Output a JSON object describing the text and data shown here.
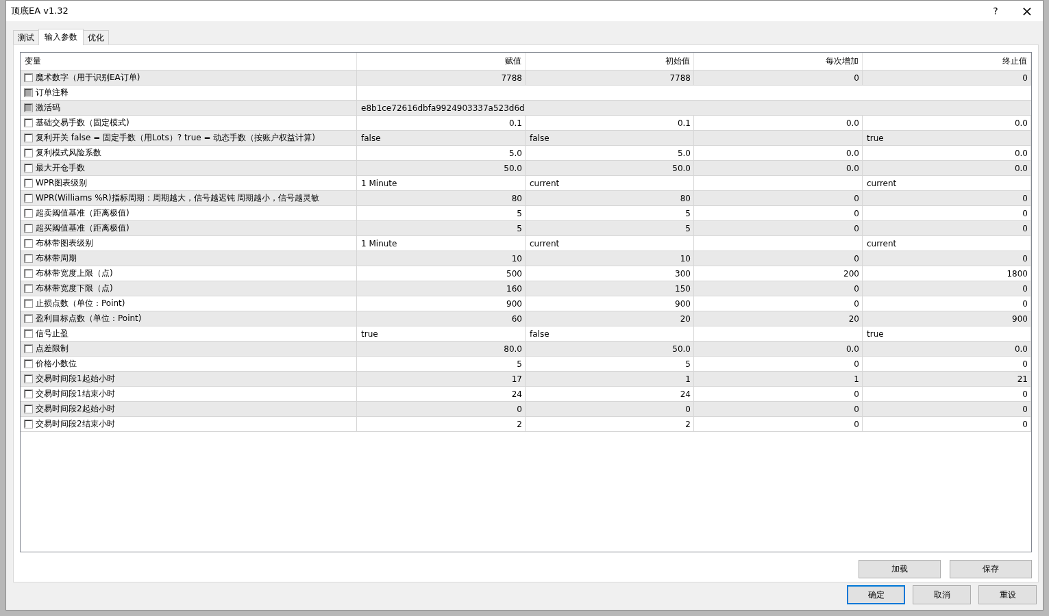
{
  "window": {
    "title": "顶底EA v1.32",
    "help": "?",
    "close": "×"
  },
  "tabs": [
    {
      "label": "测试",
      "selected": false
    },
    {
      "label": "输入参数",
      "selected": true
    },
    {
      "label": "优化",
      "selected": false
    }
  ],
  "table": {
    "columns": [
      "变量",
      "赋值",
      "初始值",
      "每次增加",
      "终止值"
    ],
    "rows": [
      {
        "kind": "number",
        "name": "魔术数字（用于识别EA订单)",
        "checked": false,
        "disabled": false,
        "value": "7788",
        "start": "7788",
        "step": "0",
        "stop": "0"
      },
      {
        "kind": "string",
        "name": "订单注释",
        "checked": false,
        "disabled": true
      },
      {
        "kind": "string",
        "name": "激活码",
        "checked": false,
        "disabled": true,
        "value": "e8b1ce72616dbfa9924903337a523d6d"
      },
      {
        "kind": "number",
        "name": "基础交易手数（固定模式)",
        "checked": false,
        "disabled": false,
        "value": "0.1",
        "start": "0.1",
        "step": "0.0",
        "stop": "0.0"
      },
      {
        "kind": "enum",
        "name": "复利开关  false = 固定手数（用Lots）? true = 动态手数（按账户权益计算)",
        "checked": false,
        "disabled": false,
        "value": "false",
        "start": "false",
        "stop": "true"
      },
      {
        "kind": "number",
        "name": "复利模式风险系数",
        "checked": false,
        "disabled": false,
        "value": "5.0",
        "start": "5.0",
        "step": "0.0",
        "stop": "0.0"
      },
      {
        "kind": "number",
        "name": "最大开仓手数",
        "checked": false,
        "disabled": false,
        "value": "50.0",
        "start": "50.0",
        "step": "0.0",
        "stop": "0.0"
      },
      {
        "kind": "enum",
        "name": "WPR图表级别",
        "checked": false,
        "disabled": false,
        "value": "1 Minute",
        "start": "current",
        "stop": "current"
      },
      {
        "kind": "number",
        "name": "WPR(Williams %R)指标周期：周期越大，信号越迟钝 周期越小，信号越灵敏",
        "checked": false,
        "disabled": false,
        "value": "80",
        "start": "80",
        "step": "0",
        "stop": "0"
      },
      {
        "kind": "number",
        "name": "超卖阈值基准（距离极值)",
        "checked": false,
        "disabled": false,
        "value": "5",
        "start": "5",
        "step": "0",
        "stop": "0"
      },
      {
        "kind": "number",
        "name": "超买阈值基准（距离极值)",
        "checked": false,
        "disabled": false,
        "value": "5",
        "start": "5",
        "step": "0",
        "stop": "0"
      },
      {
        "kind": "enum",
        "name": "布林带图表级别",
        "checked": false,
        "disabled": false,
        "value": "1 Minute",
        "start": "current",
        "stop": "current"
      },
      {
        "kind": "number",
        "name": "布林带周期",
        "checked": false,
        "disabled": false,
        "value": "10",
        "start": "10",
        "step": "0",
        "stop": "0"
      },
      {
        "kind": "number",
        "name": "布林带宽度上限（点)",
        "checked": false,
        "disabled": false,
        "value": "500",
        "start": "300",
        "step": "200",
        "stop": "1800"
      },
      {
        "kind": "number",
        "name": "布林带宽度下限（点)",
        "checked": false,
        "disabled": false,
        "value": "160",
        "start": "150",
        "step": "0",
        "stop": "0"
      },
      {
        "kind": "number",
        "name": "止损点数（单位：Point)",
        "checked": false,
        "disabled": false,
        "value": "900",
        "start": "900",
        "step": "0",
        "stop": "0"
      },
      {
        "kind": "number",
        "name": "盈利目标点数（单位：Point)",
        "checked": false,
        "disabled": false,
        "value": "60",
        "start": "20",
        "step": "20",
        "stop": "900"
      },
      {
        "kind": "enum",
        "name": "信号止盈",
        "checked": false,
        "disabled": false,
        "value": "true",
        "start": "false",
        "stop": "true"
      },
      {
        "kind": "number",
        "name": "点差限制",
        "checked": false,
        "disabled": false,
        "value": "80.0",
        "start": "50.0",
        "step": "0.0",
        "stop": "0.0"
      },
      {
        "kind": "number",
        "name": "价格小数位",
        "checked": false,
        "disabled": false,
        "value": "5",
        "start": "5",
        "step": "0",
        "stop": "0"
      },
      {
        "kind": "number",
        "name": "交易时间段1起始小时",
        "checked": false,
        "disabled": false,
        "value": "17",
        "start": "1",
        "step": "1",
        "stop": "21"
      },
      {
        "kind": "number",
        "name": "交易时间段1结束小时",
        "checked": false,
        "disabled": false,
        "value": "24",
        "start": "24",
        "step": "0",
        "stop": "0"
      },
      {
        "kind": "number",
        "name": "交易时间段2起始小时",
        "checked": false,
        "disabled": false,
        "value": "0",
        "start": "0",
        "step": "0",
        "stop": "0"
      },
      {
        "kind": "number",
        "name": "交易时间段2结束小时",
        "checked": false,
        "disabled": false,
        "value": "2",
        "start": "2",
        "step": "0",
        "stop": "0"
      }
    ]
  },
  "panel_buttons": [
    {
      "label": "加载",
      "default": false
    },
    {
      "label": "保存",
      "default": false
    }
  ],
  "dialog_buttons": [
    {
      "label": "确定",
      "default": true
    },
    {
      "label": "取消",
      "default": false
    },
    {
      "label": "重设",
      "default": false
    }
  ]
}
